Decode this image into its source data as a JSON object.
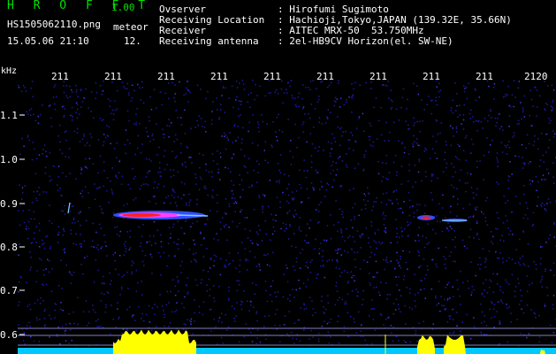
{
  "header": {
    "app_title": "H R O F F T",
    "app_version": "1.00",
    "file_name": "HS1505062110.png",
    "mode": "meteor",
    "datetime": "15.05.06 21:10",
    "meteor_count": "12."
  },
  "info": [
    {
      "key": "Ovserver",
      "value": ": Hirofumi Sugimoto"
    },
    {
      "key": "Receiving Location",
      "value": ": Hachioji,Tokyo,JAPAN (139.32E, 35.66N)"
    },
    {
      "key": "Receiver",
      "value": ": AITEC MRX-50  53.750MHz"
    },
    {
      "key": "Receiving antenna",
      "value": ": 2el-HB9CV Horizon(el. SW-NE)"
    }
  ],
  "axes": {
    "unit": "kHz",
    "y_ticks": [
      "1.1",
      "1.0",
      "0.9",
      "0.8",
      "0.7",
      "0.6"
    ],
    "x_ticks": [
      "211",
      "211",
      "211",
      "211",
      "211",
      "211",
      "211",
      "211",
      "211",
      "2120"
    ]
  },
  "colors": {
    "background": "#000000",
    "noise": "#1a1aa0",
    "echo_core": "#ff2020",
    "histogram": "#ffff00",
    "baseline": "#00c8ff",
    "title_green": "#00e000"
  }
}
